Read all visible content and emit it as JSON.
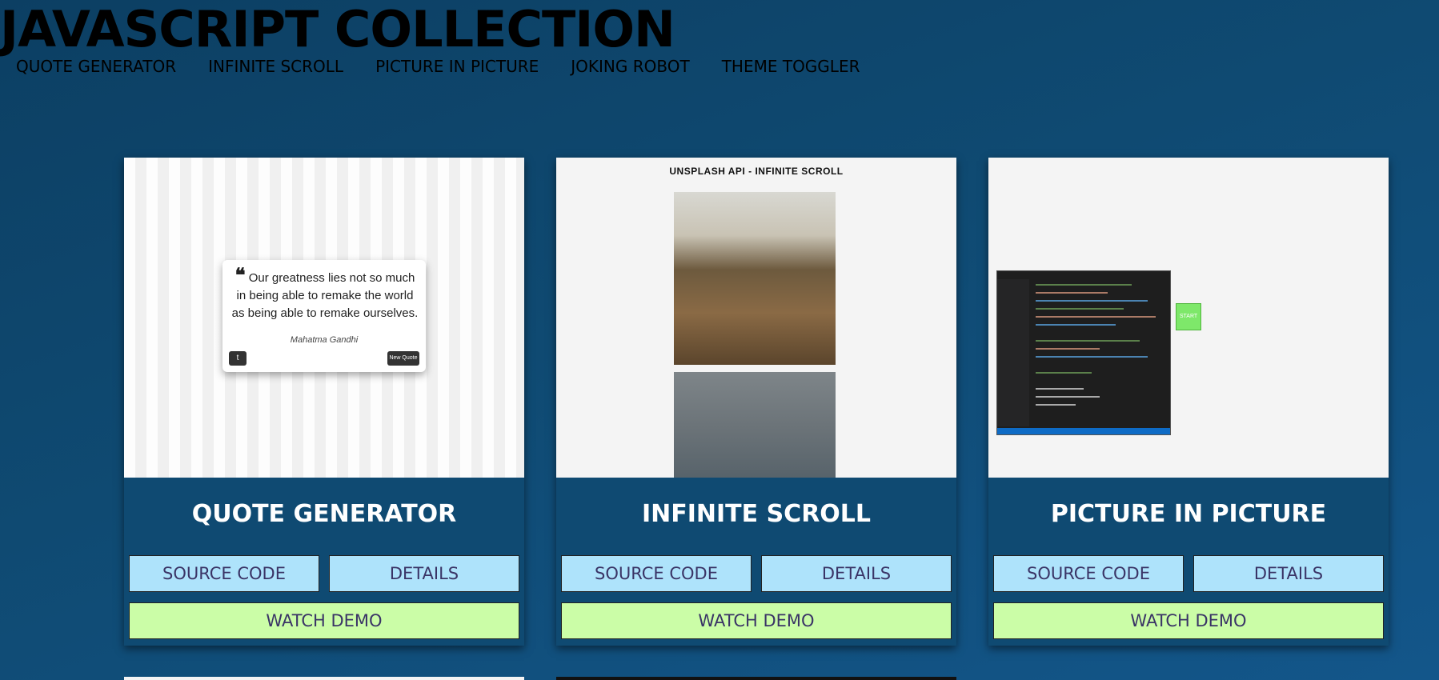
{
  "header": {
    "title": "JAVASCRIPT COLLECTION",
    "nav": [
      "QUOTE GENERATOR",
      "INFINITE SCROLL",
      "PICTURE IN PICTURE",
      "JOKING ROBOT",
      "THEME TOGGLER"
    ]
  },
  "cards": [
    {
      "title": "QUOTE GENERATOR",
      "source_label": "SOURCE CODE",
      "details_label": "DETAILS",
      "demo_label": "WATCH DEMO",
      "thumb": {
        "quote": "Our greatness lies not so much in being able to remake the world as being able to remake ourselves.",
        "author": "Mahatma Gandhi",
        "button": "New Quote"
      }
    },
    {
      "title": "INFINITE SCROLL",
      "source_label": "SOURCE CODE",
      "details_label": "DETAILS",
      "demo_label": "WATCH DEMO",
      "thumb": {
        "heading": "UNSPLASH API - INFINITE SCROLL"
      }
    },
    {
      "title": "PICTURE IN PICTURE",
      "source_label": "SOURCE CODE",
      "details_label": "DETAILS",
      "demo_label": "WATCH DEMO",
      "thumb": {
        "button": "START"
      }
    }
  ],
  "colors": {
    "background": "#0f4a72",
    "button_blue": "#aee3fb",
    "button_green": "#cbfda7",
    "button_text": "#3a3466"
  }
}
